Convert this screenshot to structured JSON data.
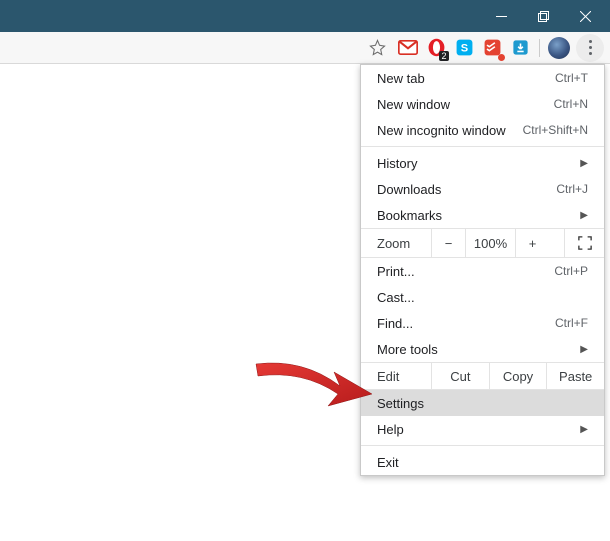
{
  "titlebar": {
    "minimize": "minimize",
    "maximize": "maximize",
    "close": "close"
  },
  "toolbar": {
    "star": "star",
    "extensions": {
      "gmail": "Gmail",
      "opera_badge": "2",
      "skype": "Skype",
      "todoist": "Todoist",
      "downloader": "Downloader"
    },
    "avatar": "Profile",
    "menu": "Customize and control"
  },
  "menu": {
    "new_tab": {
      "label": "New tab",
      "shortcut": "Ctrl+T"
    },
    "new_window": {
      "label": "New window",
      "shortcut": "Ctrl+N"
    },
    "new_incognito": {
      "label": "New incognito window",
      "shortcut": "Ctrl+Shift+N"
    },
    "history": {
      "label": "History"
    },
    "downloads": {
      "label": "Downloads",
      "shortcut": "Ctrl+J"
    },
    "bookmarks": {
      "label": "Bookmarks"
    },
    "zoom": {
      "label": "Zoom",
      "minus": "−",
      "value": "100%",
      "plus": "+"
    },
    "print": {
      "label": "Print...",
      "shortcut": "Ctrl+P"
    },
    "cast": {
      "label": "Cast..."
    },
    "find": {
      "label": "Find...",
      "shortcut": "Ctrl+F"
    },
    "more_tools": {
      "label": "More tools"
    },
    "edit": {
      "label": "Edit",
      "cut": "Cut",
      "copy": "Copy",
      "paste": "Paste"
    },
    "settings": {
      "label": "Settings"
    },
    "help": {
      "label": "Help"
    },
    "exit": {
      "label": "Exit"
    }
  }
}
